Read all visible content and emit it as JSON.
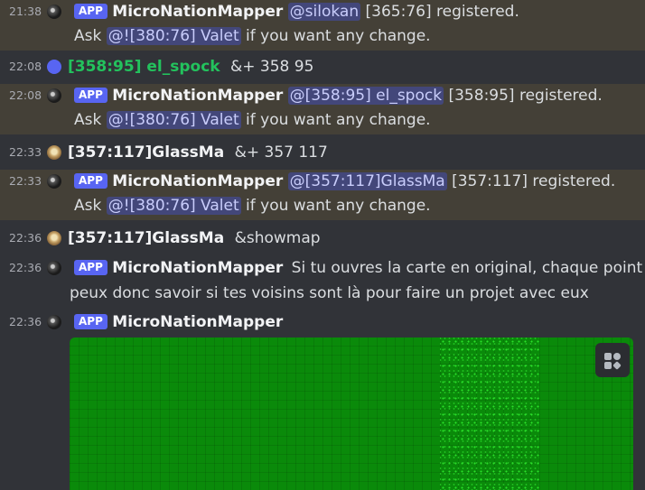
{
  "messages": [
    {
      "time": "21:38",
      "badge": "APP",
      "author": "MicroNationMapper",
      "mention1": "@silokan",
      "coord": "[365:76]",
      "registered": "registered.",
      "ask": "Ask",
      "mention2": "@![380:76] Valet",
      "tail": "if you want any change."
    },
    {
      "time": "22:08",
      "author": "[358:95] el_spock",
      "command": "&+ 358 95"
    },
    {
      "time": "22:08",
      "badge": "APP",
      "author": "MicroNationMapper",
      "mention1": "@[358:95] el_spock",
      "coord": "[358:95]",
      "registered": "registered.",
      "ask": "Ask",
      "mention2": "@![380:76] Valet",
      "tail": "if you want any change."
    },
    {
      "time": "22:33",
      "author": "[357:117]GlassMa",
      "command": "&+ 357 117"
    },
    {
      "time": "22:33",
      "badge": "APP",
      "author": "MicroNationMapper",
      "mention1": "@[357:117]GlassMa",
      "coord": "[357:117]",
      "registered": "registered.",
      "ask": "Ask",
      "mention2": "@![380:76] Valet",
      "tail": "if you want any change."
    },
    {
      "time": "22:36",
      "author": "[357:117]GlassMa",
      "command": "&showmap"
    },
    {
      "time": "22:36",
      "badge": "APP",
      "author": "MicroNationMapper",
      "text1": "Si tu ouvres la carte en original, chaque point ve",
      "text2": "peux donc savoir si tes voisins sont là pour faire un projet avec eux"
    },
    {
      "time": "22:36",
      "badge": "APP",
      "author": "MicroNationMapper"
    }
  ],
  "embed": {
    "map_color": "#0a8a0a",
    "apps_icon": "apps-icon"
  }
}
